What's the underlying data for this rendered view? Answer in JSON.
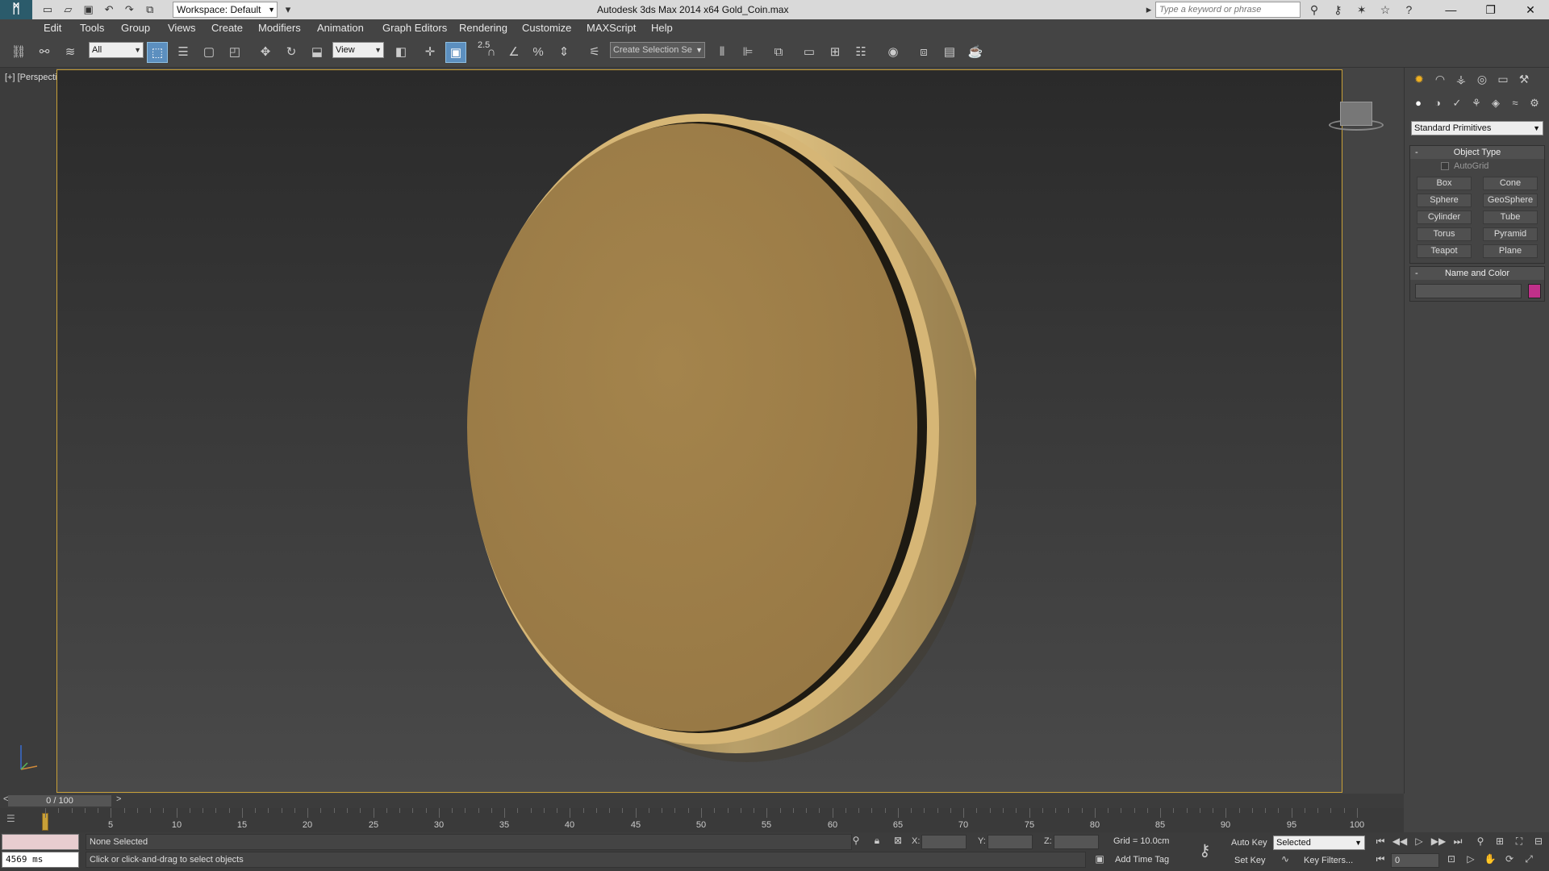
{
  "app": {
    "title": "Autodesk 3ds Max  2014 x64    Gold_Coin.max",
    "workspace": "Workspace: Default",
    "search_placeholder": "Type a keyword or phrase"
  },
  "menu": [
    "Edit",
    "Tools",
    "Group",
    "Views",
    "Create",
    "Modifiers",
    "Animation",
    "Graph Editors",
    "Rendering",
    "Customize",
    "MAXScript",
    "Help"
  ],
  "toolbar": {
    "filter_value": "All",
    "ref_coord_value": "View",
    "snap_label": "2.5",
    "selection_set_placeholder": "Create Selection Se"
  },
  "viewport": {
    "label": "[+] [Perspective ] [Shaded ]"
  },
  "command_panel": {
    "category": "Standard Primitives",
    "object_type_title": "Object Type",
    "autogrid_label": "AutoGrid",
    "primitives": [
      "Box",
      "Cone",
      "Sphere",
      "GeoSphere",
      "Cylinder",
      "Tube",
      "Torus",
      "Pyramid",
      "Teapot",
      "Plane"
    ],
    "name_color_title": "Name and Color",
    "swatch_color": "#c0308a"
  },
  "timeline": {
    "frame_label": "0 / 100",
    "left_arrow": "<",
    "right_arrow": ">",
    "ticks": [
      "5",
      "10",
      "15",
      "20",
      "25",
      "30",
      "35",
      "40",
      "45",
      "50",
      "55",
      "60",
      "65",
      "70",
      "75",
      "80",
      "85",
      "90",
      "95",
      "100"
    ]
  },
  "status": {
    "render_time": "4569 ms",
    "selection": "None Selected",
    "prompt": "Click or click-and-drag to select objects",
    "x_label": "X:",
    "y_label": "Y:",
    "z_label": "Z:",
    "grid": "Grid = 10.0cm",
    "add_time_tag": "Add Time Tag",
    "auto_key": "Auto Key",
    "set_key": "Set Key",
    "key_mode": "Selected",
    "key_filters": "Key Filters...",
    "current_frame": "0"
  },
  "colors": {
    "accent_border": "#c8a038",
    "coin_gold": "#a8874f"
  }
}
